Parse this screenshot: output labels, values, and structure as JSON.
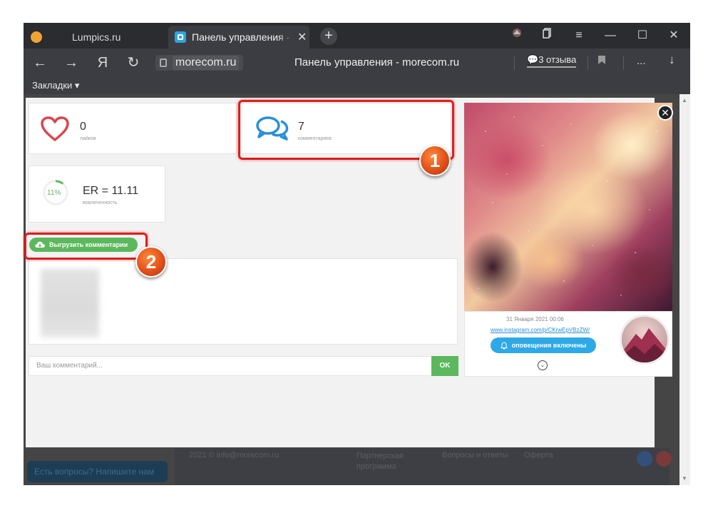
{
  "browser": {
    "tabs": [
      {
        "label": "Lumpics.ru"
      },
      {
        "label": "Панель управления - morecom.ru"
      }
    ],
    "tab_close": "✕",
    "new_tab": "+",
    "nav": {
      "back": "←",
      "forward": "→",
      "yandex": "Я",
      "reload": "↻"
    },
    "url_domain": "morecom.ru",
    "page_title": "Панель управления - morecom.ru",
    "reviews": "3 отзыва",
    "menu_dots": "...",
    "download": "↓",
    "bookmarks_label": "Закладки ▾",
    "window": {
      "minimize": "—",
      "maximize": "☐",
      "close": "✕",
      "menu": "≡"
    }
  },
  "background_page": {
    "help_button": "Есть вопросы? Напишите нам",
    "footer": [
      "2021 © info@morecom.ru",
      "Партнерская программа",
      "Вопросы и ответы",
      "Оферта"
    ]
  },
  "stats": {
    "likes_value": "0",
    "likes_label": "лайков",
    "comments_value": "7",
    "comments_label": "комментариев",
    "er_percent": "11%",
    "er_value": "ER = 11.11",
    "er_label": "вовлеченность",
    "er_fraction": 0.11
  },
  "actions": {
    "export_comments": "Выгрузить комментарии"
  },
  "comment_form": {
    "placeholder": "Ваш комментарий...",
    "ok": "OK"
  },
  "post": {
    "date": "31 Января 2021 00:06",
    "link": "www.instagram.com/p/CKrwEpVBzZW/",
    "notify_button": "оповещения включены",
    "expand": "⌄",
    "close": "✕"
  },
  "annotations": [
    {
      "number": "1"
    },
    {
      "number": "2"
    }
  ],
  "colors": {
    "accent_green": "#5cb85c",
    "accent_blue": "#2ea9e8",
    "highlight_red": "#e01c1c"
  }
}
